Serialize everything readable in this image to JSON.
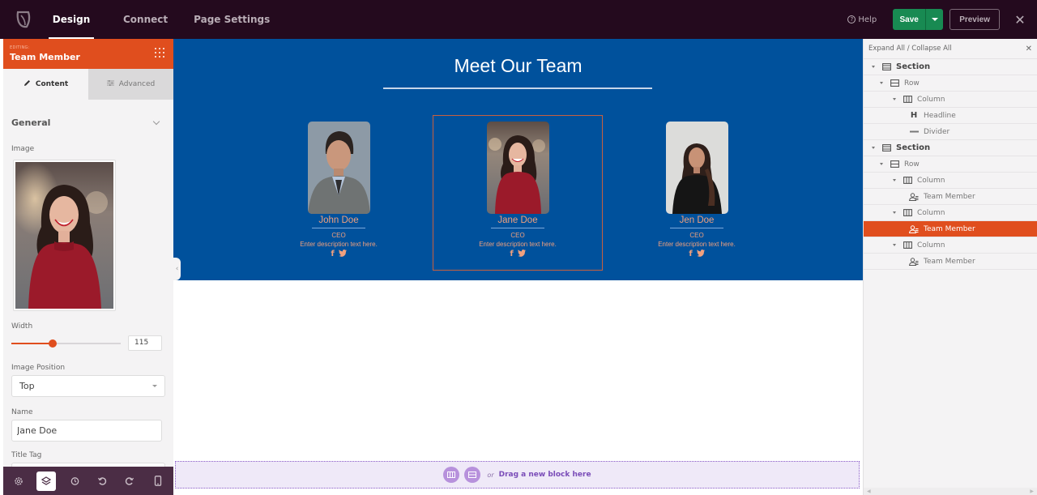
{
  "topbar": {
    "logo_icon": "leaf-logo",
    "tabs": [
      {
        "label": "Design",
        "active": true
      },
      {
        "label": "Connect",
        "active": false
      },
      {
        "label": "Page Settings",
        "active": false
      }
    ],
    "help_label": "Help",
    "save_label": "Save",
    "preview_label": "Preview",
    "close_icon": "✕"
  },
  "left_panel": {
    "editing_label": "EDITING:",
    "editing_title": "Team Member",
    "tabs": [
      {
        "label": "Content",
        "icon": "pencil-icon",
        "active": true
      },
      {
        "label": "Advanced",
        "icon": "sliders-icon",
        "active": false
      }
    ],
    "section_title": "General",
    "image_label": "Image",
    "width_label": "Width",
    "width_value": "115",
    "width_slider_fraction": 0.38,
    "image_position_label": "Image Position",
    "image_position_value": "Top",
    "name_label": "Name",
    "name_value": "Jane Doe",
    "title_tag_label": "Title Tag",
    "bottom_bar": [
      "settings-icon",
      "layers-icon",
      "history-icon",
      "undo-icon",
      "redo-icon",
      "mobile-icon"
    ]
  },
  "canvas": {
    "title": "Meet Our Team",
    "members": [
      {
        "name": "John Doe",
        "role": "CEO",
        "description": "Enter description text here.",
        "selected": false
      },
      {
        "name": "Jane Doe",
        "role": "CEO",
        "description": "Enter description text here.",
        "selected": true
      },
      {
        "name": "Jen Doe",
        "role": "CEO",
        "description": "Enter description text here.",
        "selected": false
      }
    ],
    "social": {
      "facebook": "f",
      "twitter": "twitter"
    },
    "drop_zone": {
      "or": "or",
      "text": "Drag a new block here"
    }
  },
  "right_panel": {
    "header": "Expand All / Collapse All",
    "tree": [
      {
        "label": "Section",
        "type": "section",
        "level": 0,
        "caret": true
      },
      {
        "label": "Row",
        "type": "row",
        "level": 1,
        "caret": true
      },
      {
        "label": "Column",
        "type": "column",
        "level": 2,
        "caret": true
      },
      {
        "label": "Headline",
        "type": "headline",
        "level": 3,
        "caret": false
      },
      {
        "label": "Divider",
        "type": "divider",
        "level": 3,
        "caret": false
      },
      {
        "label": "Section",
        "type": "section",
        "level": 0,
        "caret": true
      },
      {
        "label": "Row",
        "type": "row",
        "level": 1,
        "caret": true
      },
      {
        "label": "Column",
        "type": "column",
        "level": 2,
        "caret": true
      },
      {
        "label": "Team Member",
        "type": "member",
        "level": 3,
        "caret": false
      },
      {
        "label": "Column",
        "type": "column",
        "level": 2,
        "caret": true
      },
      {
        "label": "Team Member",
        "type": "member",
        "level": 3,
        "caret": false,
        "selected": true
      },
      {
        "label": "Column",
        "type": "column",
        "level": 2,
        "caret": true
      },
      {
        "label": "Team Member",
        "type": "member",
        "level": 3,
        "caret": false
      }
    ]
  },
  "colors": {
    "topbar": "#240a1e",
    "accent_orange": "#e04e1e",
    "save_green": "#188a52",
    "hero_blue": "#00519c",
    "member_text": "#f0a07e",
    "bottom_bar": "#4b2d45",
    "drop_zone": "#efe9f8"
  }
}
